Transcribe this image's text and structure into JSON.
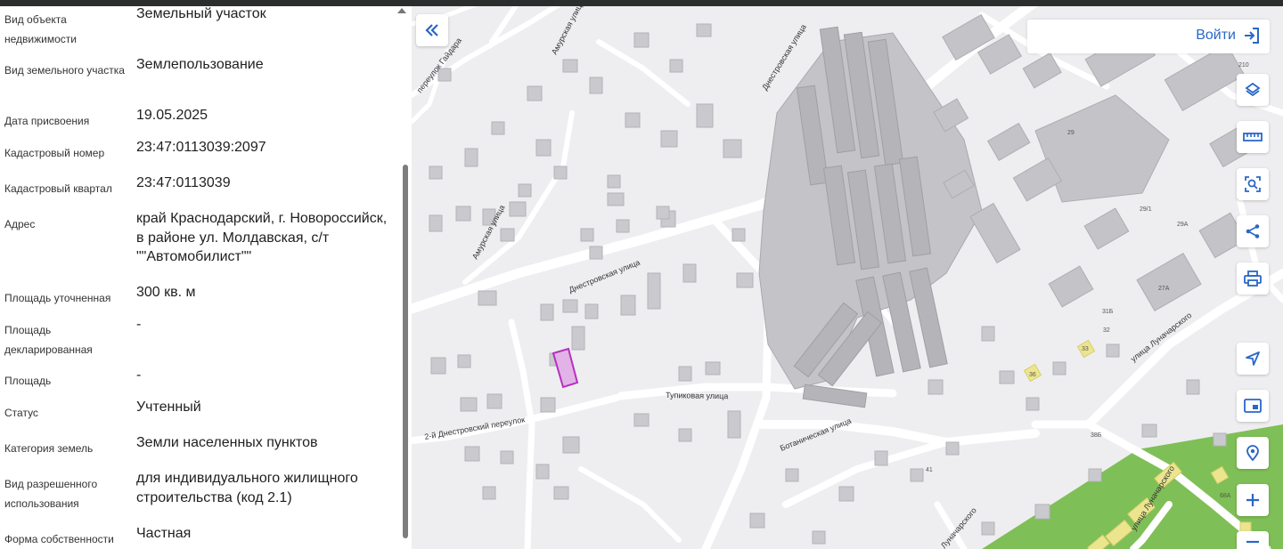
{
  "info_rows": [
    {
      "label": "Вид объекта недвижимости",
      "value": "Земельный участок"
    },
    {
      "label": "Вид земельного участка",
      "value": "Землепользование"
    },
    {
      "label": "Дата присвоения",
      "value": "19.05.2025"
    },
    {
      "label": "Кадастровый номер",
      "value": "23:47:0113039:2097"
    },
    {
      "label": "Кадастровый квартал",
      "value": "23:47:0113039"
    },
    {
      "label": "Адрес",
      "value": "край Краснодарский, г. Новороссийск, в районе ул. Молдавская, с/т \"\"Автомобилист\"\""
    },
    {
      "label": "Площадь уточненная",
      "value": "300 кв. м"
    },
    {
      "label": "Площадь декларированная",
      "value": "-"
    },
    {
      "label": "Площадь",
      "value": "-"
    },
    {
      "label": "Статус",
      "value": "Учтенный"
    },
    {
      "label": "Категория земель",
      "value": "Земли населенных пунктов"
    },
    {
      "label": "Вид разрешенного использования",
      "value": "для индивидуального жилищного строительства (код 2.1)"
    },
    {
      "label": "Форма собственности",
      "value": "Частная"
    }
  ],
  "header": {
    "login_label": "Войти"
  },
  "map": {
    "streets": [
      "переулок Гайдара",
      "Амурская улица",
      "Амурская улица",
      "Днестровская улица",
      "Днестровская улица",
      "Тупиковая улица",
      "2-й Днестровский переулок",
      "Ботаническая улица",
      "улица Луначарского",
      "улица Луначарского",
      "Луначарского"
    ],
    "house_numbers": [
      "210",
      "29",
      "29/1",
      "29А",
      "27А",
      "31Б",
      "32",
      "33",
      "36",
      "38Б",
      "41",
      "68А"
    ],
    "colors": {
      "background": "#eeeef1",
      "road": "#ffffff",
      "building": "#c4c4c8",
      "building_dark": "#b8b8bd",
      "parcel_fill": "#e2b3e6",
      "parcel_stroke": "#b531c0",
      "park": "#7fbf57",
      "yellow_building": "#ece590",
      "accent": "#2a67c6"
    }
  },
  "tools": [
    {
      "name": "layers-icon"
    },
    {
      "name": "ruler-icon"
    },
    {
      "name": "select-area-icon"
    },
    {
      "name": "share-icon"
    },
    {
      "name": "print-icon"
    },
    {
      "name": "locate-icon"
    },
    {
      "name": "minimap-icon"
    },
    {
      "name": "pin-search-icon"
    },
    {
      "name": "zoom-in-icon"
    },
    {
      "name": "zoom-out-icon"
    }
  ]
}
